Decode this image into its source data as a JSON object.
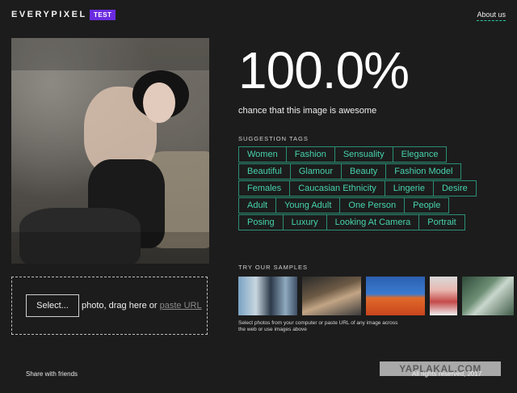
{
  "header": {
    "logo": "EVERYPIXEL",
    "badge": "TEST",
    "about_link": "About us"
  },
  "result": {
    "score": "100.0%",
    "caption": "chance that this image is awesome"
  },
  "suggestion_tags": {
    "title": "SUGGESTION TAGS",
    "rows": [
      [
        "Women",
        "Fashion",
        "Sensuality",
        "Elegance"
      ],
      [
        "Beautiful",
        "Glamour",
        "Beauty",
        "Fashion Model"
      ],
      [
        "Females",
        "Caucasian Ethnicity",
        "Lingerie",
        "Desire"
      ],
      [
        "Adult",
        "Young Adult",
        "One Person",
        "People"
      ],
      [
        "Posing",
        "Luxury",
        "Looking At Camera",
        "Portrait"
      ]
    ]
  },
  "samples": {
    "title": "TRY OUR SAMPLES",
    "note": "Select photos from your computer or paste URL of any image across the web or use images above"
  },
  "upload": {
    "select_label": "Select...",
    "middle_text": "photo, drag here or",
    "paste_link": "paste URL"
  },
  "footer": {
    "share": "Share with friends",
    "copyright": "All rights reserved, 2017",
    "watermark": "YAPLAKAL.COM"
  },
  "colors": {
    "background": "#1c1c1c",
    "accent": "#46d3ac",
    "badge": "#6b2be0"
  }
}
